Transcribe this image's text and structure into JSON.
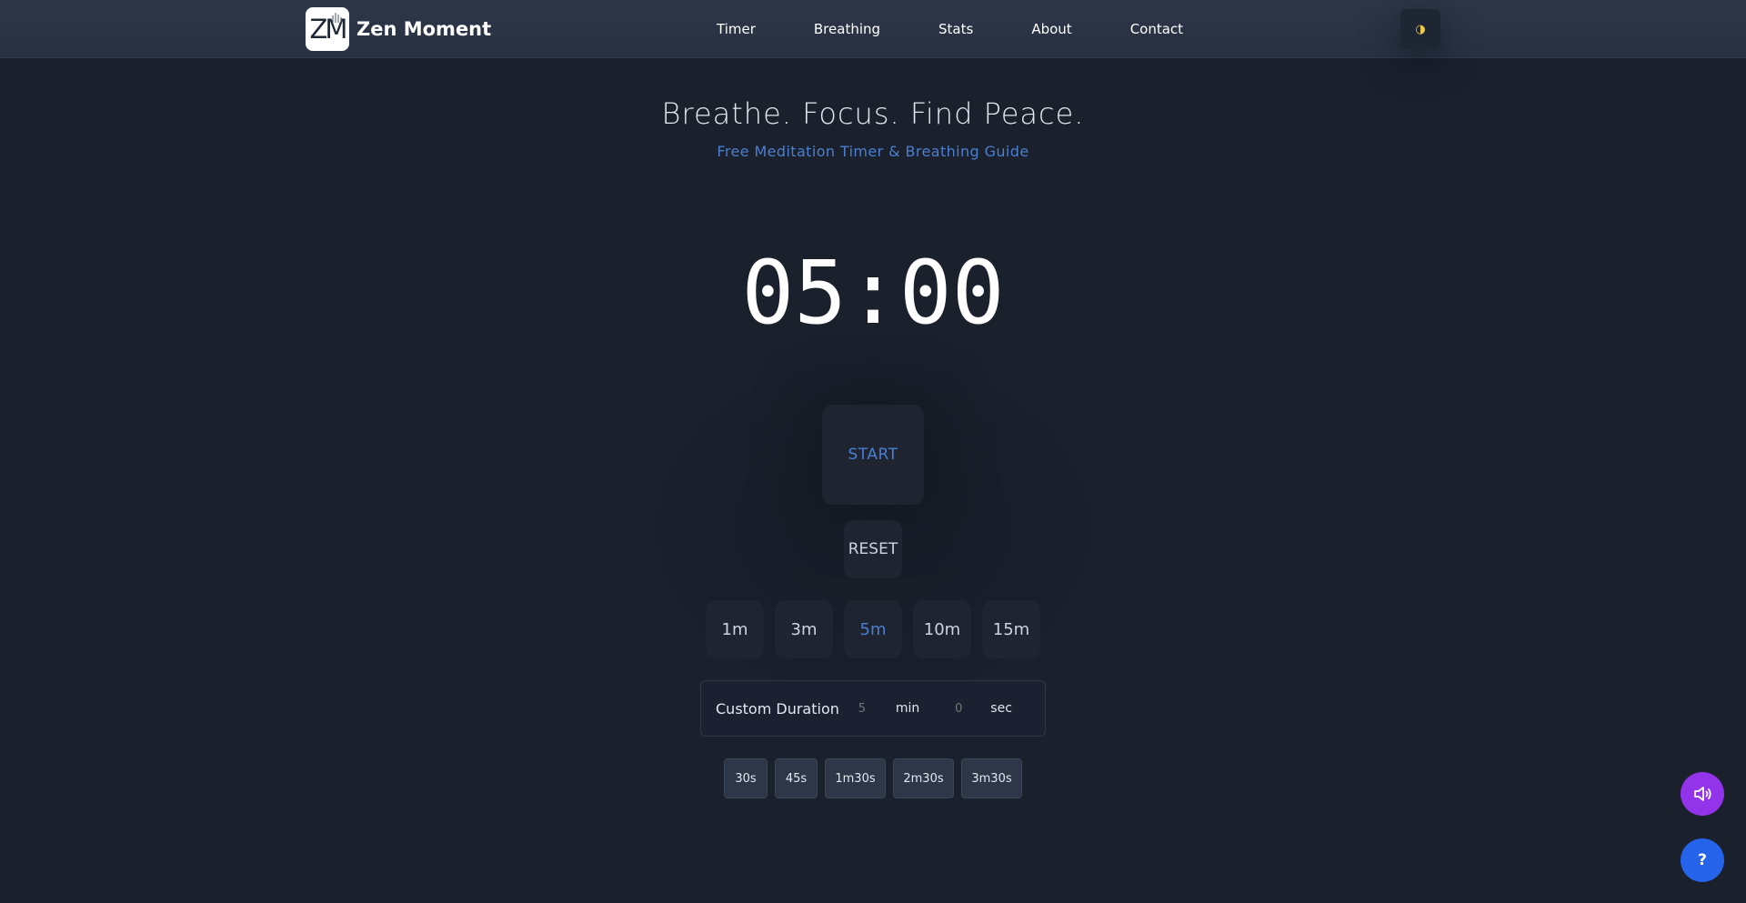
{
  "app": {
    "title": "Zen Moment",
    "logo_text": "ZM"
  },
  "nav": {
    "links": [
      {
        "label": "Timer"
      },
      {
        "label": "Breathing"
      },
      {
        "label": "Stats"
      },
      {
        "label": "About"
      },
      {
        "label": "Contact"
      }
    ],
    "theme_toggle_glyph": "◑"
  },
  "hero": {
    "title": "Breathe. Focus. Find Peace.",
    "subtitle": "Free Meditation Timer & Breathing Guide"
  },
  "timer": {
    "display": "05:00",
    "start_label": "START",
    "reset_label": "RESET"
  },
  "presets": [
    {
      "label": "1m",
      "active": false
    },
    {
      "label": "3m",
      "active": false
    },
    {
      "label": "5m",
      "active": true
    },
    {
      "label": "10m",
      "active": false
    },
    {
      "label": "15m",
      "active": false
    }
  ],
  "custom": {
    "label": "Custom Duration",
    "minutes_placeholder": "5",
    "minutes_unit": "min",
    "seconds_placeholder": "0",
    "seconds_unit": "sec"
  },
  "quick_durations": [
    {
      "label": "30s"
    },
    {
      "label": "45s"
    },
    {
      "label": "1m30s"
    },
    {
      "label": "2m30s"
    },
    {
      "label": "3m30s"
    }
  ],
  "fabs": {
    "sound_icon": "speaker-icon",
    "help_label": "?"
  },
  "colors": {
    "background": "#1a202c",
    "navbar": "#2d3748",
    "accent_blue": "#4a7fd1",
    "theme_icon": "#ecc94b",
    "sound_fab": "#9333ea",
    "help_fab": "#2563eb"
  }
}
